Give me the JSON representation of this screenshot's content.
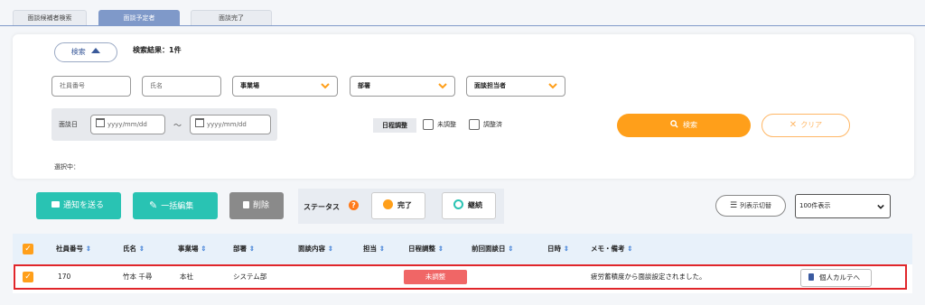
{
  "tabs": [
    {
      "label": "面談候補者検索"
    },
    {
      "label": "面談予定者"
    },
    {
      "label": "面談完了"
    }
  ],
  "search": {
    "toggle_label": "検索",
    "result_label": "検索結果：1件",
    "employee_no_placeholder": "社員番号",
    "name_placeholder": "氏名",
    "office_value": "事業場",
    "dept_value": "部署",
    "person_value": "面談担当者",
    "date_label": "面談日",
    "date_from_placeholder": "yyyy/mm/dd",
    "date_sep": "～",
    "date_to_placeholder": "yyyy/mm/dd",
    "schedule_label": "日程調整",
    "unadjusted_label": "未調整",
    "adjusted_label": "調整済",
    "search_button": "検索",
    "clear_button": "クリア",
    "selected_label": "選択中："
  },
  "actions": {
    "notify": "通知を送る",
    "bulk_edit": "一括編集",
    "delete": "削除",
    "status_label": "ステータス",
    "done": "完了",
    "continue": "継続",
    "column_toggle": "列表示切替",
    "per_page": "100件表示"
  },
  "table": {
    "headers": [
      "社員番号",
      "氏名",
      "事業場",
      "部署",
      "面談内容",
      "担当",
      "日程調整",
      "前回面談日",
      "日時",
      "メモ・備考"
    ],
    "row": {
      "employee_no": "170",
      "name": "竹本 千尋",
      "office": "本社",
      "dept": "システム部",
      "content": "",
      "person": "",
      "schedule": "未調整",
      "last_date": "",
      "datetime": "",
      "memo": "疲労蓄積度から面談設定されました。",
      "karte": "個人カルテへ"
    }
  },
  "colors": {
    "orange": "#ff9f1a",
    "teal": "#29c3b3",
    "grey_btn": "#8a8a8a",
    "tab_active": "#7f99c9",
    "red_badge": "#f06666",
    "highlight": "#e0262b"
  }
}
